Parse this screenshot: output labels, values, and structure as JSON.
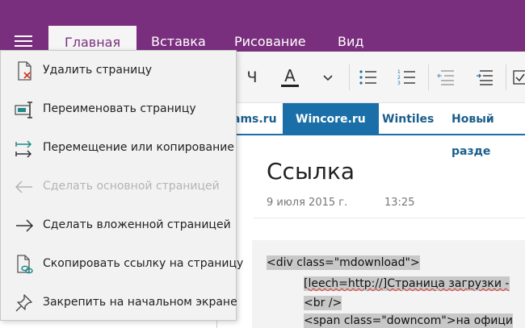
{
  "header": {
    "tabs": [
      {
        "label": "Главная"
      },
      {
        "label": "Вставка"
      },
      {
        "label": "Рисование"
      },
      {
        "label": "Вид"
      }
    ]
  },
  "ribbon": {
    "underline_glyph": "Ч",
    "font_color_glyph": "A",
    "font_color_accent": "#222222"
  },
  "sections": [
    {
      "label": "ams.ru"
    },
    {
      "label": "Wincore.ru"
    },
    {
      "label": "Wintiles"
    },
    {
      "label": "Новый разде"
    }
  ],
  "page": {
    "title": "Ссылка",
    "date": "9 июля 2015 г.",
    "time": "13:25",
    "code_lines": [
      "<div class=\"mdownload\">",
      "[leech=http://]Страница загрузки -",
      "<br />",
      "<span class=\"downcom\">на офици"
    ]
  },
  "menu": {
    "items": [
      {
        "label": "Удалить страницу",
        "icon": "delete-page-icon",
        "disabled": false
      },
      {
        "label": "Переименовать страницу",
        "icon": "rename-page-icon",
        "disabled": false
      },
      {
        "label": "Перемещение или копирование",
        "icon": "move-copy-icon",
        "disabled": false
      },
      {
        "label": "Сделать основной страницей",
        "icon": "arrow-left-icon",
        "disabled": true
      },
      {
        "label": "Сделать вложенной страницей",
        "icon": "arrow-right-icon",
        "disabled": false
      },
      {
        "label": "Скопировать ссылку на страницу",
        "icon": "copy-link-icon",
        "disabled": false
      },
      {
        "label": "Закрепить на начальном экране",
        "icon": "pin-icon",
        "disabled": false
      }
    ]
  },
  "colors": {
    "brand_purple": "#7a2f7e",
    "section_blue": "#1a6fa8",
    "accent_icon_teal": "#1f8a8a",
    "delete_red": "#d9342b"
  }
}
